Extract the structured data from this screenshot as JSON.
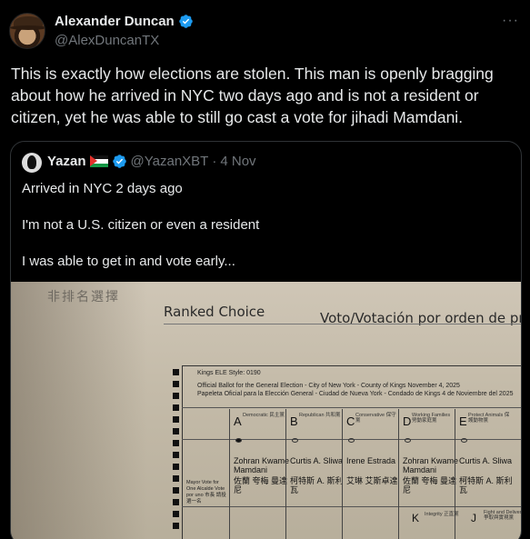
{
  "post": {
    "author_name": "Alexander Duncan",
    "author_handle": "@AlexDuncanTX",
    "more_label": "···",
    "text": "This is exactly how elections are stolen. This man is openly bragging about how he arrived in NYC two days ago and is not a resident or citizen, yet he was able to still go cast a vote for jihadi Mamdani."
  },
  "quote": {
    "author_name": "Yazan",
    "author_handle": "@YazanXBT",
    "separator": "·",
    "date": "4 Nov",
    "lines": [
      "Arrived in NYC 2 days ago",
      "I'm not a U.S. citizen or even a resident",
      "I was able to get in and vote early..."
    ]
  },
  "ballot": {
    "chinese_header": "非排名選擇",
    "ranked_choice": "Ranked Choice",
    "voto": "Voto/Votación por orden de prefer",
    "meta1": "Kings ELE Style: 0190",
    "meta2": "Official Ballot for the General Election - City of New York - County of Kings November 4, 2025",
    "meta3": "Papeleta Oficial para la Elección General - Ciudad de Nueva York - Condado de Kings 4 de Noviembre del 2025",
    "columns": [
      {
        "letter": "A",
        "party": "Democratic 民主黨",
        "name": "Zohran Kwame Mamdani",
        "cn": "佐蘭 夸梅 曼達尼",
        "filled": true
      },
      {
        "letter": "B",
        "party": "Republican 共和黨",
        "name": "Curtis A. Sliwa",
        "cn": "柯特斯 A. 斯利瓦",
        "filled": false
      },
      {
        "letter": "C",
        "party": "Conservative 保守黨",
        "name": "Irene Estrada",
        "cn": "艾琳 艾斯卓達",
        "filled": false
      },
      {
        "letter": "D",
        "party": "Working Families 勞動家庭黨",
        "name": "Zohran Kwame Mamdani",
        "cn": "佐蘭 夸梅 曼達尼",
        "filled": false
      },
      {
        "letter": "E",
        "party": "Protect Animals 保護動物黨",
        "name": "Curtis A. Sliwa",
        "cn": "柯特斯 A. 斯利瓦",
        "filled": false
      }
    ],
    "mayor": "Mayor Vote for One Alcalde Vote por uno 市長 請投選一名",
    "k_letter": "K",
    "k_party": "Integrity 正直黨",
    "j_letter": "J",
    "j_party": "Fight and Deliver 爭取與實現黨"
  }
}
